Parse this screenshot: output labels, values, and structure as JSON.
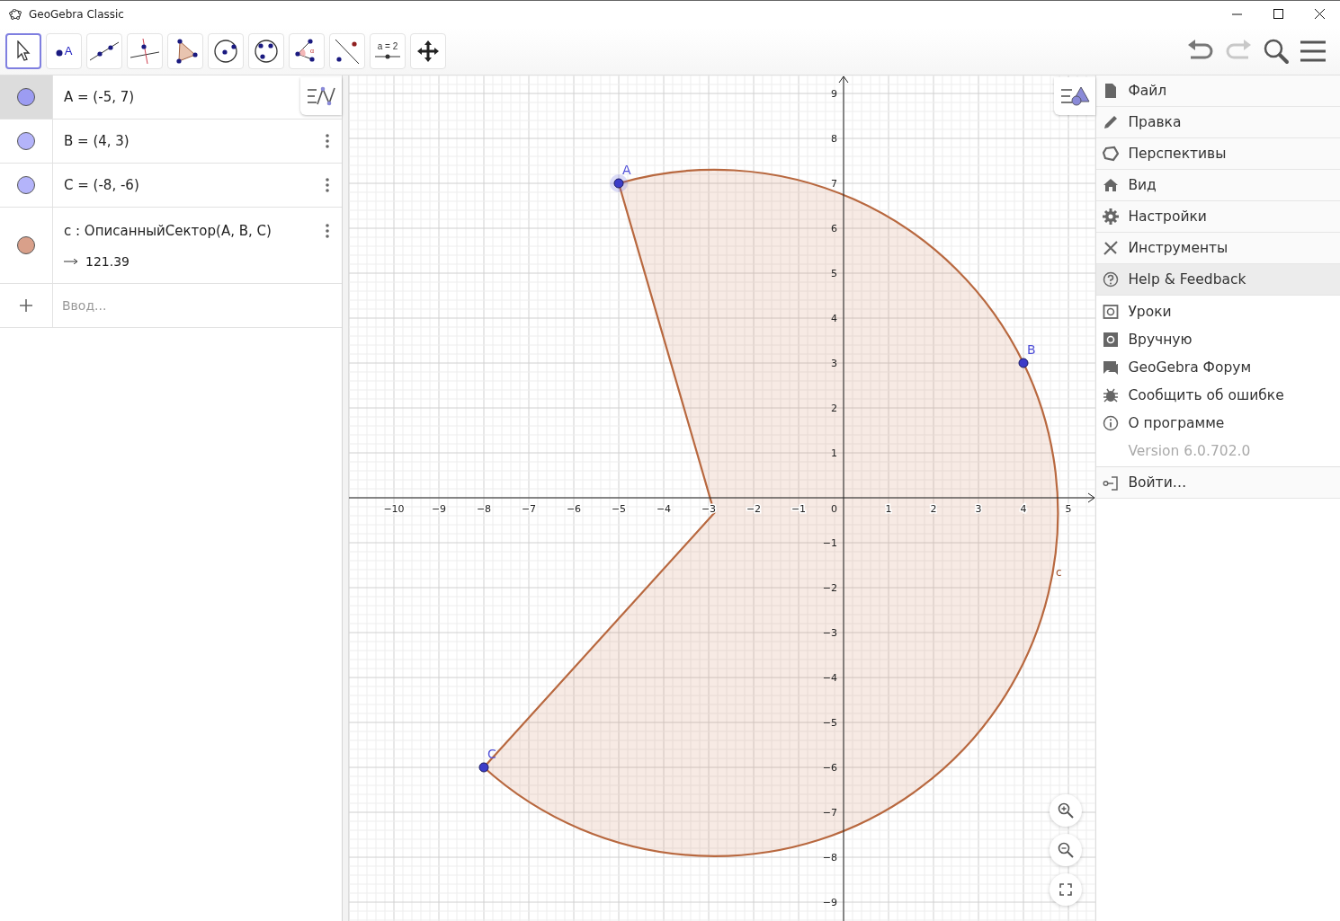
{
  "window": {
    "title": "GeoGebra Classic"
  },
  "toolbar": {
    "tools": [
      {
        "kind": "move",
        "selected": true
      },
      {
        "kind": "point",
        "label": "A",
        "selected": false
      },
      {
        "kind": "line",
        "selected": false
      },
      {
        "kind": "perpendicular",
        "selected": false
      },
      {
        "kind": "polygon",
        "selected": false
      },
      {
        "kind": "circle",
        "selected": false
      },
      {
        "kind": "circle3",
        "selected": false
      },
      {
        "kind": "angle",
        "label": "α",
        "selected": false
      },
      {
        "kind": "reflect",
        "selected": false
      },
      {
        "kind": "slider",
        "label": "a = 2",
        "selected": false
      },
      {
        "kind": "pan",
        "selected": false
      }
    ],
    "actions": [
      {
        "kind": "undo",
        "disabled": false
      },
      {
        "kind": "redo",
        "disabled": true
      },
      {
        "kind": "search"
      },
      {
        "kind": "menu"
      }
    ]
  },
  "algebra": {
    "items": [
      {
        "kind": "point",
        "text": "A = (-5, 7)",
        "color": "#9c9cf2",
        "selected": true
      },
      {
        "kind": "point",
        "text": "B = (4, 3)",
        "color": "#b4b4fa",
        "selected": false
      },
      {
        "kind": "point",
        "text": "C = (-8, -6)",
        "color": "#b4b4fa",
        "selected": false
      },
      {
        "kind": "sector",
        "text": "c : ОписанныйСектор(A, B, C)",
        "value": "121.39",
        "color": "#d9a08a",
        "selected": false
      }
    ],
    "input": {
      "placeholder": "Ввод..."
    }
  },
  "graphics": {
    "chart_data": {
      "type": "scatter",
      "grid": true,
      "xlim": [
        -11,
        5.6
      ],
      "ylim": [
        -9.42,
        9.4
      ],
      "xticks": [
        {
          "value": -10,
          "label": "−10"
        },
        {
          "value": -9,
          "label": "−9"
        },
        {
          "value": -8,
          "label": "−8"
        },
        {
          "value": -7,
          "label": "−7"
        },
        {
          "value": -6,
          "label": "−6"
        },
        {
          "value": -5,
          "label": "−5"
        },
        {
          "value": -4,
          "label": "−4"
        },
        {
          "value": -3,
          "label": "−3"
        },
        {
          "value": -2,
          "label": "−2"
        },
        {
          "value": -1,
          "label": "−1"
        },
        {
          "value": 1,
          "label": "1"
        },
        {
          "value": 2,
          "label": "2"
        },
        {
          "value": 3,
          "label": "3"
        },
        {
          "value": 4,
          "label": "4"
        },
        {
          "value": 5,
          "label": "5"
        }
      ],
      "yticks": [
        {
          "value": -9,
          "label": "−9"
        },
        {
          "value": -8,
          "label": "−8"
        },
        {
          "value": -7,
          "label": "−7"
        },
        {
          "value": -6,
          "label": "−6"
        },
        {
          "value": -5,
          "label": "−5"
        },
        {
          "value": -4,
          "label": "−4"
        },
        {
          "value": -3,
          "label": "−3"
        },
        {
          "value": -2,
          "label": "−2"
        },
        {
          "value": -1,
          "label": "−1"
        },
        {
          "value": 1,
          "label": "1"
        },
        {
          "value": 2,
          "label": "2"
        },
        {
          "value": 3,
          "label": "3"
        },
        {
          "value": 4,
          "label": "4"
        },
        {
          "value": 5,
          "label": "5"
        },
        {
          "value": 6,
          "label": "6"
        },
        {
          "value": 7,
          "label": "7"
        },
        {
          "value": 8,
          "label": "8"
        },
        {
          "value": 9,
          "label": "9"
        }
      ],
      "x": [
        -5,
        4,
        -8
      ],
      "series": [
        {
          "color": "#3c3cc8",
          "values": [
            7,
            3,
            -6
          ]
        }
      ],
      "value_labels": [
        "A",
        "B",
        "C"
      ],
      "annotations": [
        "c"
      ]
    },
    "origin_label": "0"
  },
  "menu": {
    "items": [
      {
        "kind": "file",
        "label": "Файл",
        "expanded": false
      },
      {
        "kind": "edit",
        "label": "Правка",
        "expanded": false
      },
      {
        "kind": "perspectives",
        "label": "Перспективы",
        "expanded": false
      },
      {
        "kind": "view",
        "label": "Вид",
        "expanded": false
      },
      {
        "kind": "settings",
        "label": "Настройки",
        "expanded": false
      },
      {
        "kind": "tools",
        "label": "Инструменты",
        "expanded": false
      },
      {
        "kind": "help",
        "label": "Help & Feedback",
        "expanded": true,
        "children": [
          {
            "kind": "tutorials",
            "label": "Уроки"
          },
          {
            "kind": "manual",
            "label": "Вручную"
          },
          {
            "kind": "forum",
            "label": "GeoGebra Форум"
          },
          {
            "kind": "bug",
            "label": "Сообщить об ошибке"
          },
          {
            "kind": "about",
            "label": "О программе"
          }
        ],
        "version": "Version 6.0.702.0"
      },
      {
        "kind": "signin",
        "label": "Войти…",
        "expanded": false
      }
    ]
  }
}
